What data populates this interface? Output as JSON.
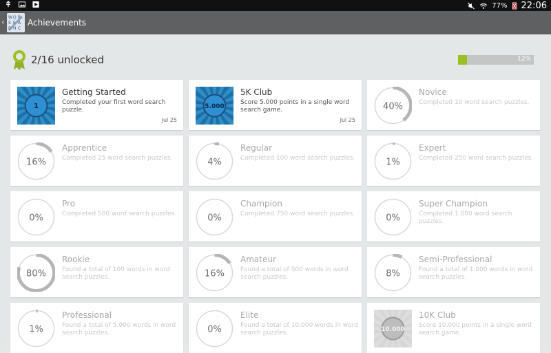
{
  "status_bar": {
    "battery": "77%",
    "time": "22:06"
  },
  "action_bar": {
    "title": "Achievements"
  },
  "summary": {
    "unlocked_text": "2/16 unlocked",
    "progress_label": "12%",
    "progress_fraction": 0.12,
    "accent_color": "#9cbf22"
  },
  "achievements": [
    {
      "name": "Getting Started",
      "desc": "Completed your first word search puzzle.",
      "date": "Jul 25",
      "unlocked": true,
      "badge_text": "1",
      "progress": 1
    },
    {
      "name": "5K Club",
      "desc": "Score 5.000 points in a single word search game.",
      "date": "Jul 25",
      "unlocked": true,
      "badge_text": "5.000",
      "progress": 1
    },
    {
      "name": "Novice",
      "desc": "Completed 10 word search puzzles.",
      "unlocked": false,
      "percent": "40%",
      "progress": 0.4
    },
    {
      "name": "Apprentice",
      "desc": "Completed 25 word search puzzles.",
      "unlocked": false,
      "percent": "16%",
      "progress": 0.16
    },
    {
      "name": "Regular",
      "desc": "Completed 100 word search puzzles.",
      "unlocked": false,
      "percent": "4%",
      "progress": 0.04
    },
    {
      "name": "Expert",
      "desc": "Completed 250 word search puzzles.",
      "unlocked": false,
      "percent": "1%",
      "progress": 0.01
    },
    {
      "name": "Pro",
      "desc": "Completed 500 word search puzzles.",
      "unlocked": false,
      "percent": "0%",
      "progress": 0
    },
    {
      "name": "Champion",
      "desc": "Completed 750 word search puzzles.",
      "unlocked": false,
      "percent": "0%",
      "progress": 0
    },
    {
      "name": "Super Champion",
      "desc": "Completed 1.000 word search puzzles.",
      "unlocked": false,
      "percent": "0%",
      "progress": 0
    },
    {
      "name": "Rookie",
      "desc": "Found a total of 100 words in word search puzzles.",
      "unlocked": false,
      "percent": "80%",
      "progress": 0.8
    },
    {
      "name": "Amateur",
      "desc": "Found a total of 500 words in word search puzzles.",
      "unlocked": false,
      "percent": "16%",
      "progress": 0.16
    },
    {
      "name": "Semi-Professional",
      "desc": "Found a total of 1.000 words in word search puzzles.",
      "unlocked": false,
      "percent": "8%",
      "progress": 0.08
    },
    {
      "name": "Professional",
      "desc": "Found a total of 5.000 words in word search puzzles.",
      "unlocked": false,
      "percent": "1%",
      "progress": 0.01
    },
    {
      "name": "Elite",
      "desc": "Found a total of 10.000 words in word search puzzles.",
      "unlocked": false,
      "percent": "0%",
      "progress": 0
    },
    {
      "name": "10K Club",
      "desc": "Score 10.000 points in a single word search game.",
      "unlocked": false,
      "badge_text": "10.000",
      "progress": 0
    }
  ]
}
